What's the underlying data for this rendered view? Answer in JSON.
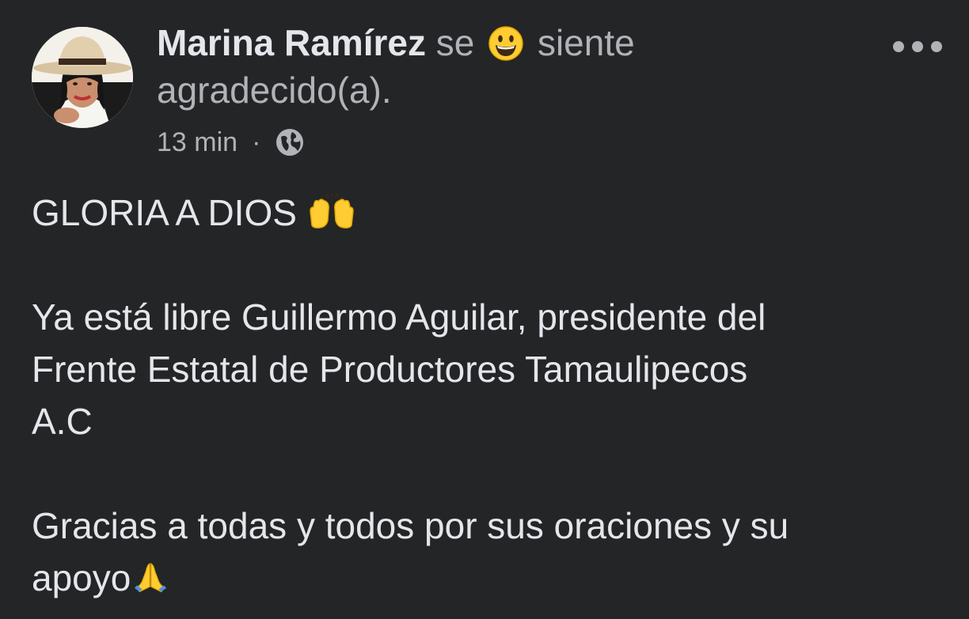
{
  "post": {
    "author": "Marina Ramírez",
    "feeling_prefix": "se",
    "feeling_icon": "grinning-face-emoji",
    "feeling_suffix": "siente",
    "feeling_line2": "agradecido(a).",
    "time": "13 min",
    "separator": "·",
    "audience_icon": "globe-icon",
    "more_icon": "more-options-icon",
    "lines": {
      "l1": "GLORIA A DIOS",
      "l1_icon": "raising-hands-emoji",
      "l2": "Ya está libre Guillermo Aguilar,  presidente del",
      "l3": "Frente Estatal de Productores Tamaulipecos",
      "l4": "A.C",
      "l5": "Gracias a todas y todos por sus oraciones y su",
      "l6": "apoyo",
      "l6_icon": "folded-hands-emoji"
    }
  },
  "colors": {
    "background": "#242526",
    "primary_text": "#e4e6eb",
    "secondary_text": "#b0b3b8",
    "emoji_yellow": "#ffcc33"
  }
}
